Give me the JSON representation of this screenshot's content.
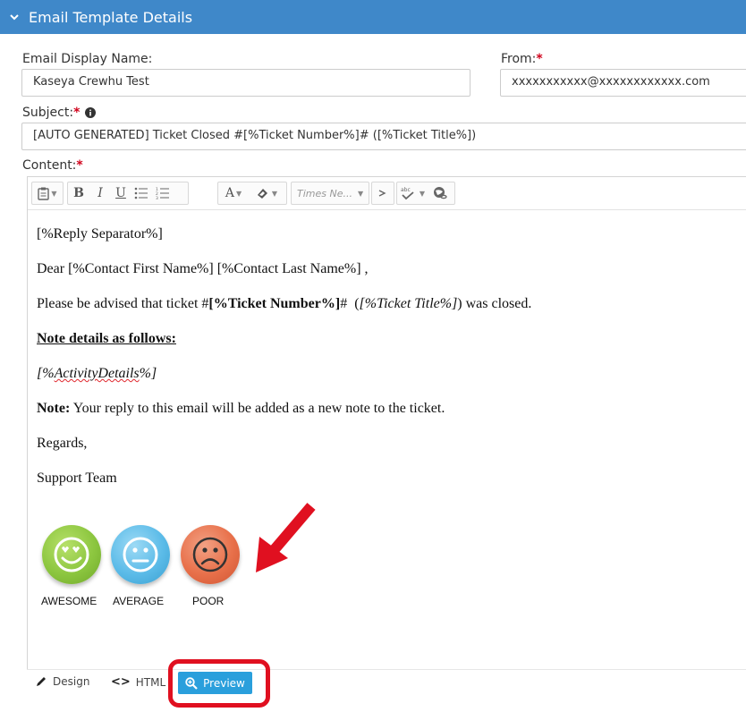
{
  "header": {
    "title": "Email Template Details"
  },
  "fields": {
    "display_name": {
      "label": "Email Display Name:",
      "value": "Kaseya Crewhu Test"
    },
    "from": {
      "label": "From:",
      "required": "*",
      "value": "xxxxxxxxxxx@xxxxxxxxxxxx.com"
    },
    "subject": {
      "label": "Subject:",
      "required": "*",
      "value": "[AUTO GENERATED] Ticket Closed #[%Ticket Number%]# ([%Ticket Title%])"
    },
    "content": {
      "label": "Content:",
      "required": "*"
    }
  },
  "toolbar": {
    "font_placeholder": "Times Ne..."
  },
  "body": {
    "reply_separator": "[%Reply Separator%]",
    "greeting": "Dear [%Contact First Name%] [%Contact Last Name%] ,",
    "advised_prefix": "Please be advised that ticket #",
    "ticket_number": "[%Ticket Number%]",
    "advised_hash": "#",
    "advised_paren_open": "  (",
    "ticket_title": "[%Ticket Title%]",
    "advised_suffix": ") was closed.",
    "note_heading": "Note details as follows:",
    "activity_details_prefix": "[%",
    "activity_details_word": "ActivityDetails",
    "activity_details_suffix": "%]",
    "note_label": "Note:",
    "note_text": " Your reply to this email will be added as a new note to the ticket.",
    "regards": "Regards,",
    "signature": "Support Team"
  },
  "ratings": [
    {
      "label": "AWESOME",
      "color": "#8cc63f"
    },
    {
      "label": "AVERAGE",
      "color": "#5bbbe8"
    },
    {
      "label": "POOR",
      "color": "#e8704a"
    }
  ],
  "tabs": {
    "design": "Design",
    "html": "HTML",
    "preview": "Preview"
  },
  "colors": {
    "header": "#3f88c9",
    "preview_button": "#2a9fdc",
    "annotation": "#e01020"
  }
}
